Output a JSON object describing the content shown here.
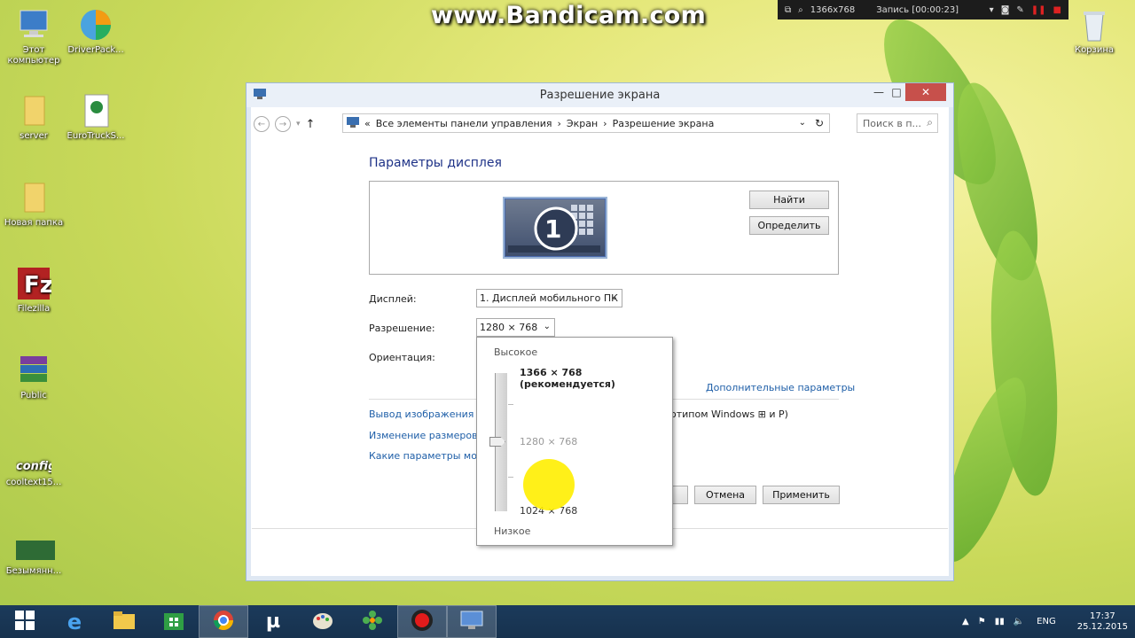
{
  "watermark": "www.Bandicam.com",
  "bandicam": {
    "resolution": "1366x768",
    "recording": "Запись [00:00:23]"
  },
  "desktop": [
    {
      "label": "Этот компьютер"
    },
    {
      "label": "DriverPack..."
    },
    {
      "label": "server"
    },
    {
      "label": "EuroTruckS..."
    },
    {
      "label": "Новая папка"
    },
    {
      "label": "Filezilla"
    },
    {
      "label": "Public"
    },
    {
      "label": "cooltext15..."
    },
    {
      "label": "Безымянн..."
    },
    {
      "label": "Корзина"
    }
  ],
  "window": {
    "title": "Разрешение экрана",
    "breadcrumb": {
      "prefix": "«",
      "items": [
        "Все элементы панели управления",
        "Экран",
        "Разрешение экрана"
      ]
    },
    "search_placeholder": "Поиск в п...",
    "heading": "Параметры дисплея",
    "monitor_number": "1",
    "find_button": "Найти",
    "identify_button": "Определить",
    "display_label": "Дисплей:",
    "display_value": "1. Дисплей мобильного ПК",
    "resolution_label": "Разрешение:",
    "resolution_value": "1280 × 768",
    "orientation_label": "Ориентация:",
    "advanced_link": "Дополнительные параметры",
    "links": [
      "Вывод изображения на",
      "Изменение размеров те",
      "Какие параметры мони"
    ],
    "links_tail": "отипом Windows",
    "links_tail2": "и P)",
    "cancel_button": "Отмена",
    "apply_button": "Применить"
  },
  "dropdown": {
    "high": "Высокое",
    "low": "Низкое",
    "options": [
      {
        "label": "1366 × 768 (рекомендуется)"
      },
      {
        "label": "1280 × 768"
      },
      {
        "label": "1024 × 768"
      }
    ]
  },
  "taskbar": {
    "lang": "ENG",
    "time": "17:37",
    "date": "25.12.2015"
  }
}
